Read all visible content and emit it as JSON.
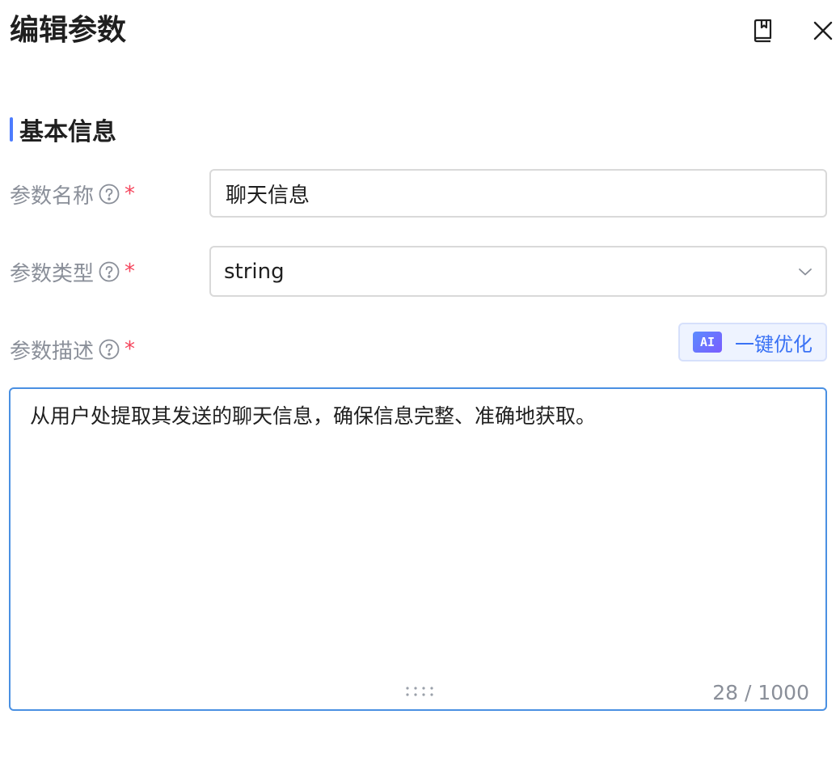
{
  "header": {
    "title": "编辑参数",
    "book_icon": "book-icon",
    "close_icon": "close-icon"
  },
  "section": {
    "title": "基本信息",
    "accent_color": "#4d7cfe"
  },
  "fields": {
    "name": {
      "label": "参数名称",
      "required_mark": "*",
      "value": "聊天信息"
    },
    "type": {
      "label": "参数类型",
      "required_mark": "*",
      "value": "string"
    },
    "description": {
      "label": "参数描述",
      "required_mark": "*",
      "value": "从用户处提取其发送的聊天信息，确保信息完整、准确地获取。",
      "count": "28",
      "separator": " / ",
      "max": "1000"
    }
  },
  "ai_optimize": {
    "badge": "AI",
    "label": "一键优化"
  },
  "colors": {
    "required": "#f5455c",
    "focus_border": "#4a90e2",
    "ai_text": "#3a72f5"
  }
}
